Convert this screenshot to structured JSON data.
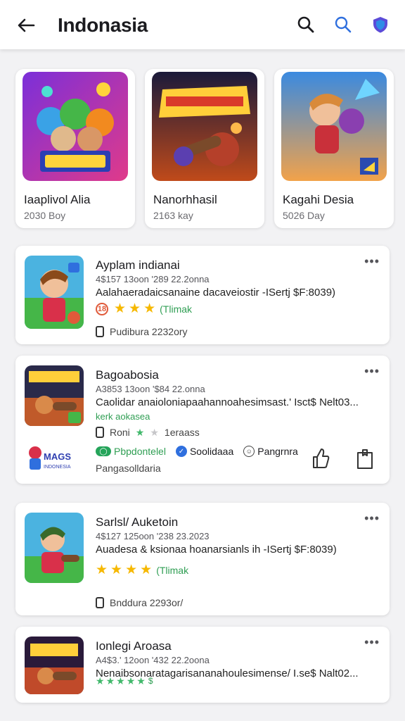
{
  "header": {
    "title": "Indonasia",
    "icons": [
      "back-arrow-icon",
      "search-icon",
      "search-blue-icon",
      "shield-icon"
    ]
  },
  "featured": [
    {
      "title": "Iaaplivol Alia",
      "subtitle": "2030 Boy"
    },
    {
      "title": "Nanorhhasil",
      "subtitle": "2163 kay"
    },
    {
      "title": "Kagahi Desia",
      "subtitle": "5026 Day"
    }
  ],
  "list": [
    {
      "name": "Ayplam indianai",
      "meta": "4$157 13oon '289 22.2onna",
      "desc": "Aalahaeradaicsanaine dacaveiostir -ISertj $F:8039)",
      "age_badge": "18",
      "rating_text": "(Tlimak",
      "footer": "Pudibura   2232ory"
    },
    {
      "name": "Bagoabosia",
      "meta": "A3853 13oon '$84 22.onna",
      "desc": "Caolidar anaioloniapaahannoahesimsast.' Isct$ Nelt03...",
      "tag": "kerk aokasea",
      "rating_text": "Roni",
      "rating_extra": "1eraass",
      "actions": [
        {
          "label": "Pbpdontelel"
        },
        {
          "label": "Soolidaaa"
        },
        {
          "label": "Pangrnra"
        }
      ],
      "side_label": "Pangasolldaria"
    },
    {
      "name": "Sarlsl/ Auketoin",
      "meta": "4$127 125oon '238 23.2023",
      "desc": "Auadesa & ksionaa hoanarsianls ih -ISertj $F:8039)",
      "rating_text": "(Tlimak",
      "footer": "Bnddura   2293or/"
    },
    {
      "name": "Ionlegi Aroasa",
      "meta": "A4$3.' 12oon '432 22.2oona",
      "desc": "Nenaibsonaratagarisananahoulesimense/ I.se$ Nalt02...",
      "rating_text": "$"
    }
  ],
  "colors": {
    "star": "#f6b800",
    "green": "#2f9e53",
    "blue": "#2f6fde",
    "background": "#f2f2f4"
  }
}
